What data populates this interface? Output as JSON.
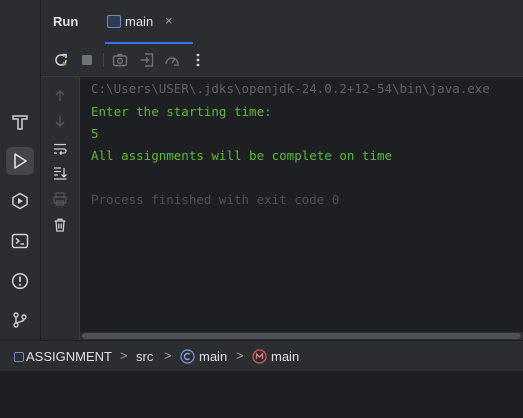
{
  "tool_window": {
    "title": "Run",
    "tab": {
      "label": "main",
      "close": "×"
    }
  },
  "console": {
    "lines": [
      {
        "text": "C:\\Users\\USER\\.jdks\\openjdk-24.0.2+12-54\\bin\\java.exe",
        "color": "#5f6166"
      },
      {
        "text": "Enter the starting time:",
        "color": "#5fb83a"
      },
      {
        "text": "5",
        "color": "#5fb83a"
      },
      {
        "text": "All assignments will be complete on time",
        "color": "#5fb83a"
      },
      {
        "text": "",
        "color": "#5f6166"
      },
      {
        "text": "Process finished with exit code 0",
        "color": "#4e5054"
      }
    ]
  },
  "breadcrumb": {
    "project": "ASSIGNMENT",
    "folder": "src",
    "class": "main",
    "method": "main",
    "separator": ">"
  },
  "colors": {
    "accent": "#3574f0",
    "console_output": "#5fb83a",
    "console_dim": "#5f6166"
  },
  "icons": {
    "activity": [
      "hammer-icon",
      "run-icon",
      "services-icon",
      "terminal-icon",
      "problems-icon",
      "git-icon"
    ],
    "toolbar": [
      "rerun-icon",
      "stop-icon",
      "screenshot-icon",
      "exit-icon",
      "profiler-icon",
      "more-icon"
    ],
    "gutter": [
      "up-arrow-icon",
      "down-arrow-icon",
      "soft-wrap-icon",
      "scroll-to-end-icon",
      "print-icon",
      "trash-icon"
    ]
  }
}
